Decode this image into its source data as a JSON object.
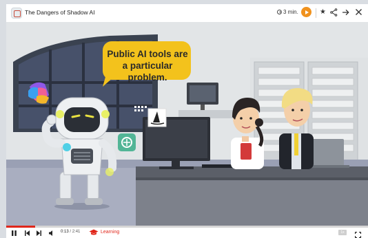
{
  "header": {
    "title": "The Dangers of Shadow AI",
    "duration": "3 min.",
    "icons": [
      "course-logo-icon",
      "clock-icon",
      "play-icon",
      "star-icon",
      "share-icon",
      "arrow-right-icon",
      "close-icon"
    ]
  },
  "video": {
    "speech_bubble": "Public AI tools are a particular problem."
  },
  "player": {
    "current_time": "0:13",
    "separator": "/",
    "total_time": "2:41",
    "progress_fraction": 0.08,
    "chapter_label": "Learning",
    "speed_label": "1x"
  },
  "colors": {
    "accent": "#e0261a",
    "orange": "#f0921e",
    "bubble": "#f3c21c"
  }
}
